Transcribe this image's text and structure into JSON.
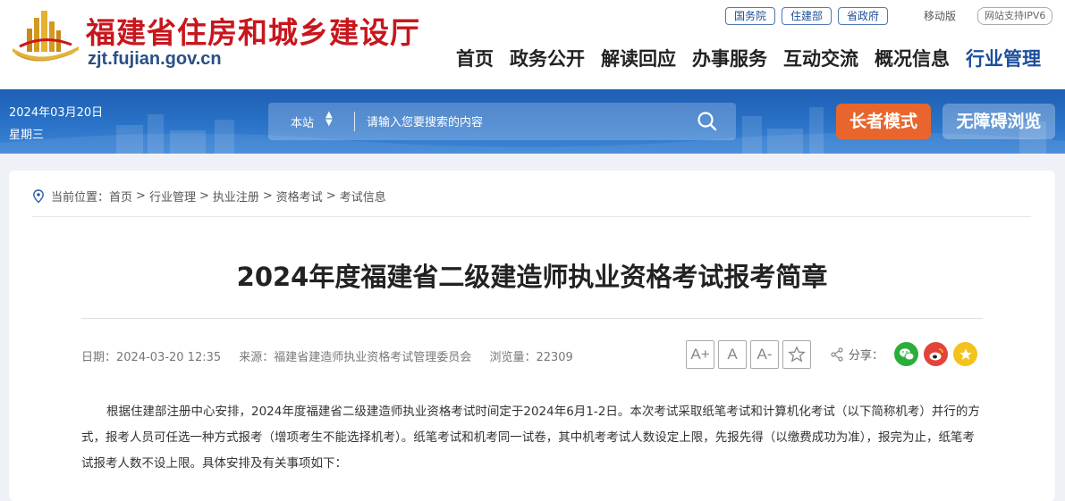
{
  "header": {
    "site_name": "福建省住房和城乡建设厅",
    "site_domain": "zjt.fujian.gov.cn",
    "top_links": [
      "国务院",
      "住建部",
      "省政府"
    ],
    "mobile_label": "移动版",
    "ipv6_label": "网站支持IPV6",
    "nav": [
      "首页",
      "政务公开",
      "解读回应",
      "办事服务",
      "互动交流",
      "概况信息",
      "行业管理"
    ],
    "active_nav": "行业管理"
  },
  "banner": {
    "date": "2024年03月20日",
    "weekday": "星期三",
    "search_scope": "本站",
    "search_placeholder": "请输入您要搜索的内容",
    "elder_mode_label": "长者模式",
    "accessibility_label": "无障碍浏览"
  },
  "breadcrumb": {
    "prefix": "当前位置：",
    "items": [
      "首页",
      "行业管理",
      "执业注册",
      "资格考试",
      "考试信息"
    ]
  },
  "article": {
    "title": "2024年度福建省二级建造师执业资格考试报考简章",
    "date_label": "日期：2024-03-20 12:35",
    "source_label": "来源：福建省建造师执业资格考试管理委员会",
    "views_label": "浏览量：22309",
    "font_buttons": [
      "A+",
      "A",
      "A-"
    ],
    "share_label": "分享：",
    "paragraph": "根据住建部注册中心安排，2024年度福建省二级建造师执业资格考试时间定于2024年6月1-2日。本次考试采取纸笔考试和计算机化考试（以下简称机考）并行的方式，报考人员可任选一种方式报考（增项考生不能选择机考）。纸笔考试和机考同一试卷，其中机考考试人数设定上限，先报先得（以缴费成功为准），报完为止，纸笔考试报考人数不设上限。具体安排及有关事项如下："
  },
  "colors": {
    "brand_red": "#c8161d",
    "nav_active": "#1b4f9c",
    "banner_blue": "#2a73c8",
    "elder_orange": "#e8662d",
    "wechat_green": "#2aae3a",
    "weibo_red": "#e2443a",
    "fav_yellow": "#f4c21c"
  },
  "icons": [
    "logo-emblem",
    "search-icon",
    "location-pin-icon",
    "star-icon",
    "share-icon",
    "wechat-icon",
    "weibo-icon",
    "favorite-icon"
  ]
}
